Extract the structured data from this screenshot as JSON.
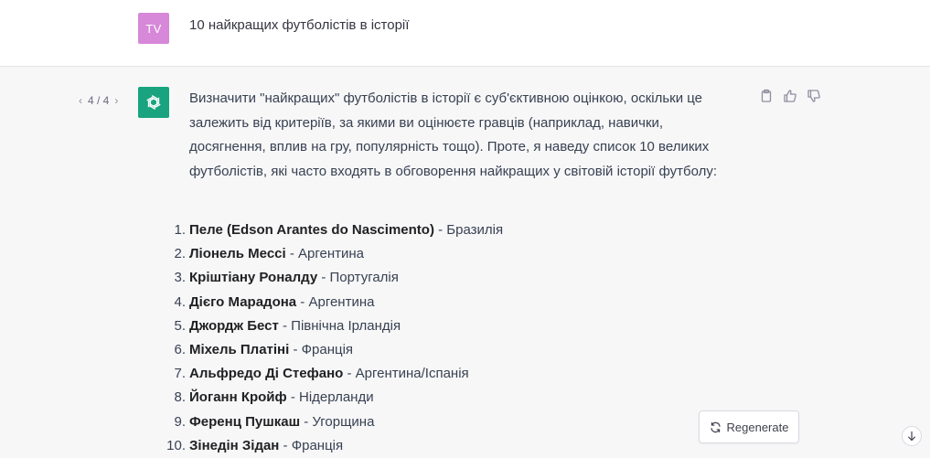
{
  "user": {
    "avatar_initials": "TV",
    "message": "10 найкращих футболістів в історії"
  },
  "assistant": {
    "pager": "4 / 4",
    "intro": "Визначити \"найкращих\" футболістів в історії є суб'єктивною оцінкою, оскільки це залежить від критеріїв, за якими ви оцінюєте гравців (наприклад, навички, досягнення, вплив на гру, популярність тощо). Проте, я наведу список 10 великих футболістів, які часто входять в обговорення найкращих у світовій історії футболу:",
    "players": [
      {
        "num": "1.",
        "name": "Пеле (Edson Arantes do Nascimento)",
        "country": " - Бразилія"
      },
      {
        "num": "2.",
        "name": "Ліонель Мессі",
        "country": " - Аргентина"
      },
      {
        "num": "3.",
        "name": "Кріштіану Роналду",
        "country": " - Португалія"
      },
      {
        "num": "4.",
        "name": "Дієго Марадона",
        "country": " - Аргентина"
      },
      {
        "num": "5.",
        "name": "Джордж Бест",
        "country": " - Північна Ірландія"
      },
      {
        "num": "6.",
        "name": "Міхель Платіні",
        "country": " - Франція"
      },
      {
        "num": "7.",
        "name": "Альфредо Ді Стефано",
        "country": " - Аргентина/Іспанія"
      },
      {
        "num": "8.",
        "name": "Йоганн Кройф",
        "country": " - Нідерланди"
      },
      {
        "num": "9.",
        "name": "Ференц Пушкаш",
        "country": " - Угорщина"
      },
      {
        "num": "10.",
        "name": "Зінедін Зідан",
        "country": " - Франція"
      }
    ]
  },
  "regenerate_label": "Regenerate",
  "icons": {
    "copy": "clipboard-icon",
    "like": "thumbs-up-icon",
    "dislike": "thumbs-down-icon",
    "regen": "refresh-icon",
    "scroll": "arrow-down-icon"
  },
  "colors": {
    "user_avatar": "#d788d8",
    "bot_avatar": "#19a37f"
  }
}
